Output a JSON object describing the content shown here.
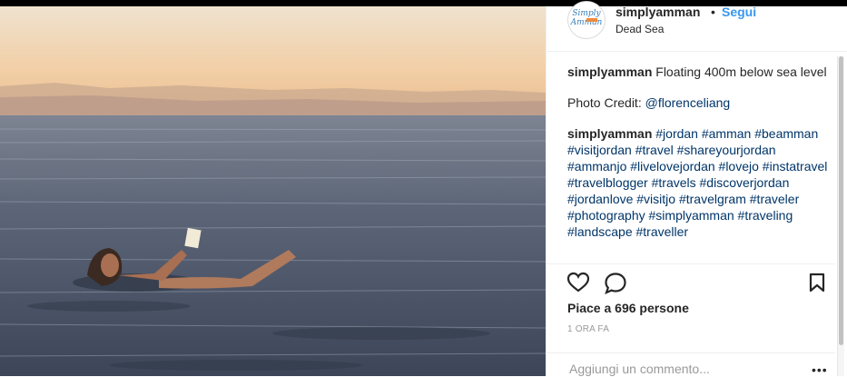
{
  "post": {
    "username": "simplyamman",
    "dot": "•",
    "follow_label": "Segui",
    "location": "Dead Sea",
    "avatar_text_line1": "Simply",
    "avatar_text_line2": "Amman"
  },
  "caption": {
    "username": "simplyamman",
    "text": "Floating 400m below sea level"
  },
  "credit": {
    "label": "Photo Credit:",
    "handle": "@florenceliang"
  },
  "tags_comment": {
    "username": "simplyamman",
    "hashtags": "#jordan #amman #beamman #visitjordan #travel #shareyourjordan #ammanjo #livelovejordan #lovejo #instatravel #travelblogger #travels #discoverjordan #jordanlove #visitjo #travelgram #traveler #photography #simplyamman #traveling #landscape #traveller"
  },
  "actions": {
    "like_icon": "heart-icon",
    "comment_icon": "comment-icon",
    "save_icon": "bookmark-icon"
  },
  "likes_text": "Piace a 696 persone",
  "timestamp": "1 ORA FA",
  "comment_box": {
    "placeholder": "Aggiungi un commento...",
    "more_icon": "ellipsis-icon"
  },
  "colors": {
    "link": "#003569",
    "follow": "#3897f0",
    "sky_top": "#f3d9b8",
    "sea": "#4a5a6e"
  }
}
